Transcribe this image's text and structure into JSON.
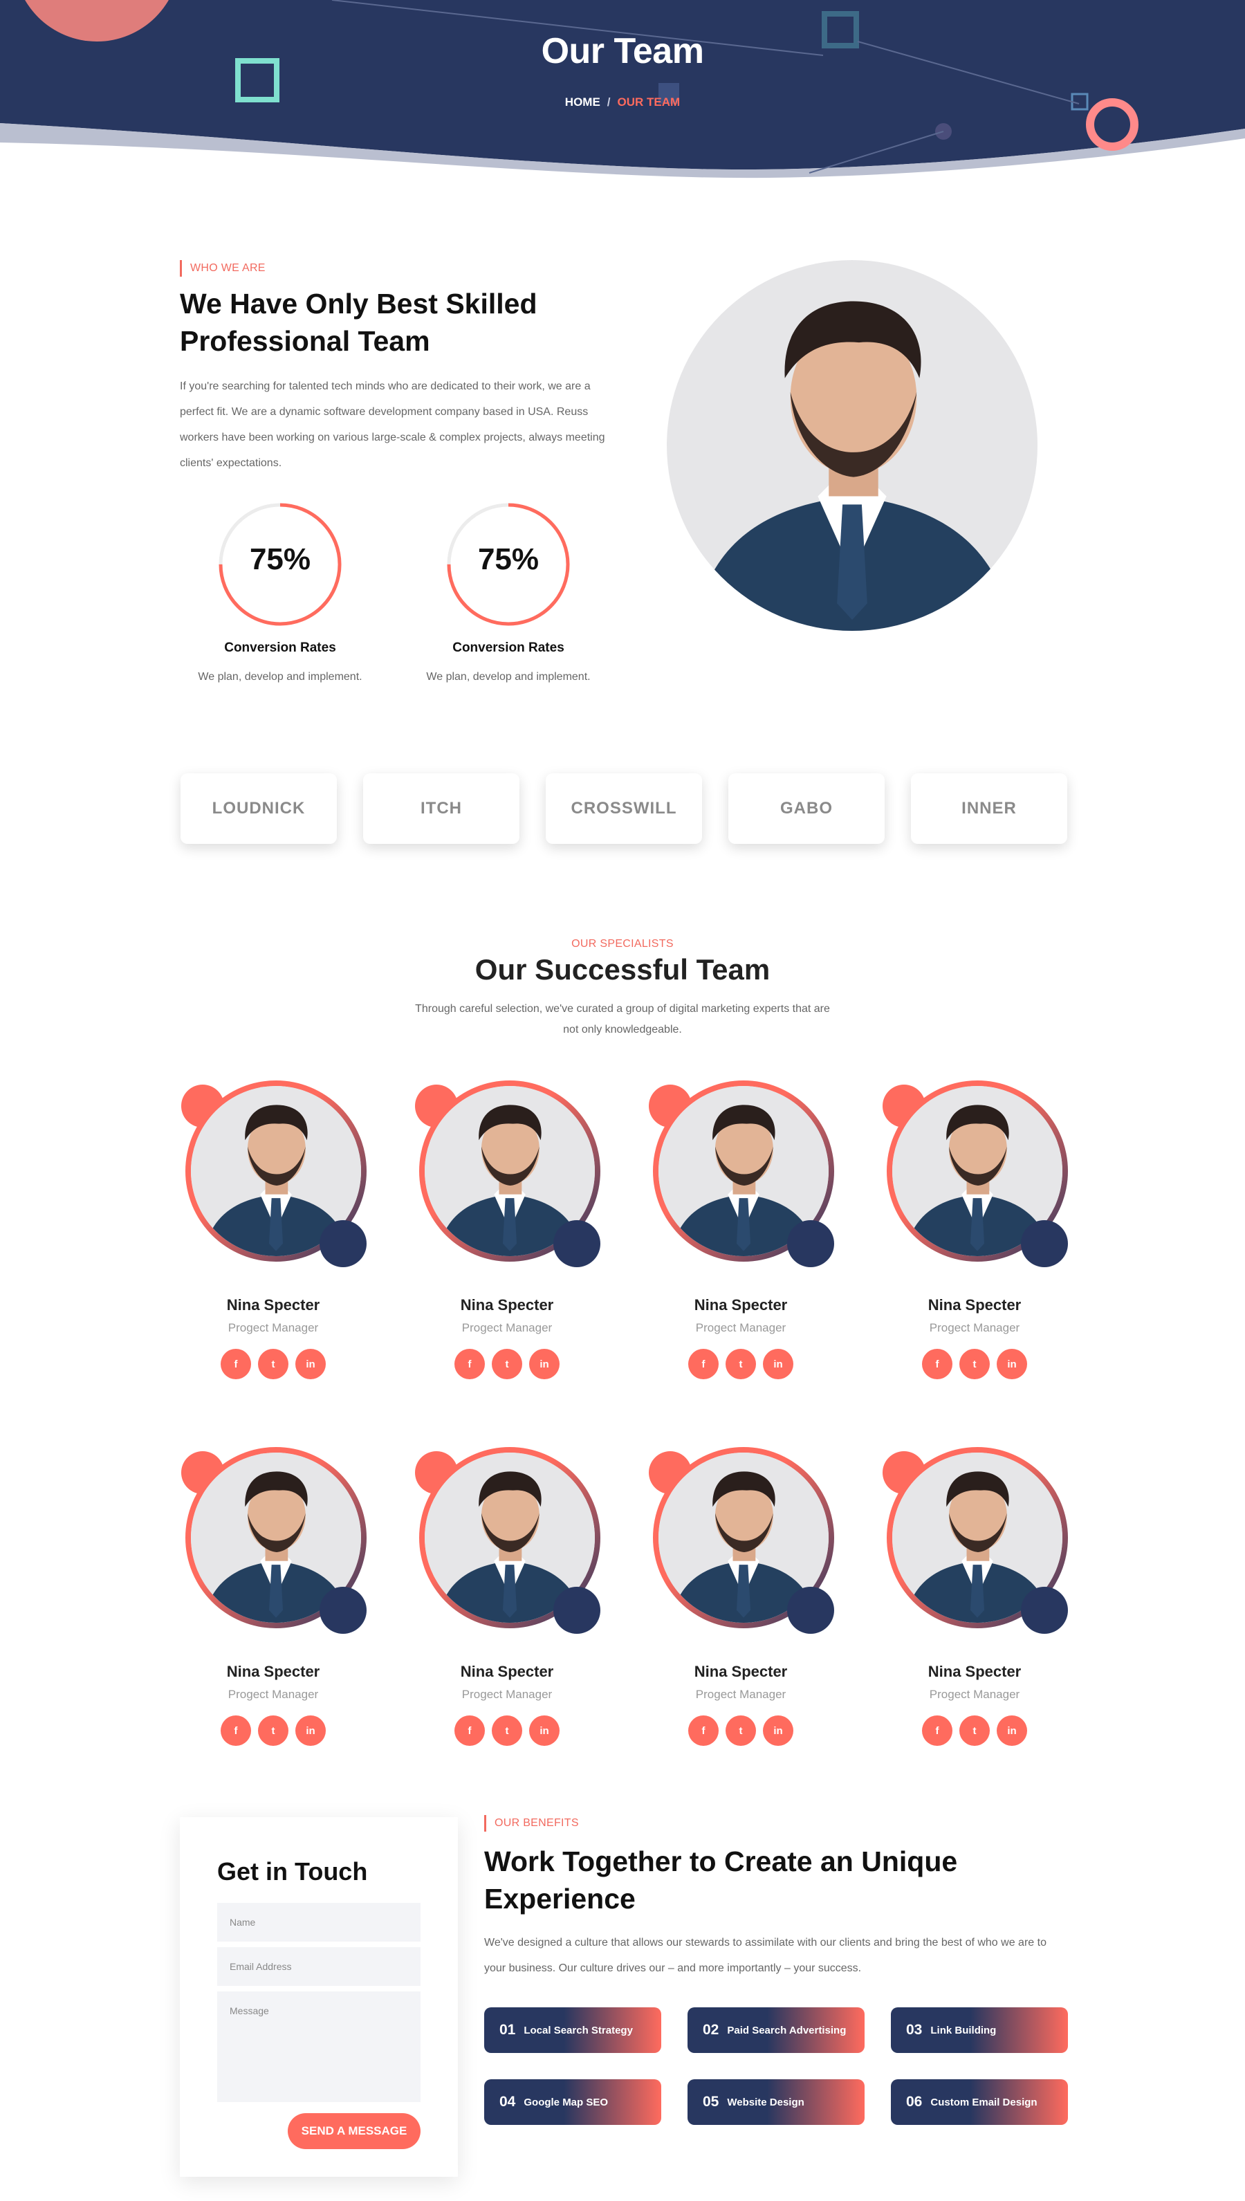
{
  "hero": {
    "title": "Our Team",
    "breadcrumb": {
      "home": "HOME",
      "separator": "/",
      "current": "OUR TEAM"
    }
  },
  "about": {
    "eyebrow": "WHO WE ARE",
    "title": "We Have Only Best Skilled Professional Team",
    "text": "If you're searching for talented tech minds who are dedicated to their work, we are a perfect fit. We are a dynamic software development company based in USA. Reuss workers have been working on various large-scale & complex projects, always meeting clients' expectations.",
    "stats": [
      {
        "value": "75%",
        "percent": 75,
        "label": "Conversion Rates",
        "desc": "We plan, develop and implement."
      },
      {
        "value": "75%",
        "percent": 75,
        "label": "Conversion Rates",
        "desc": "We plan, develop and implement."
      }
    ]
  },
  "logos": [
    "LOUDNICK",
    "ITCH",
    "CROSSWILL",
    "GABO",
    "INNER"
  ],
  "team": {
    "eyebrow": "OUR SPECIALISTS",
    "title": "Our Successful Team",
    "subtitle": "Through careful selection, we've curated a group of digital marketing experts that are not only knowledgeable.",
    "members": [
      {
        "name": "Nina Specter",
        "role": "Progect Manager"
      },
      {
        "name": "Nina Specter",
        "role": "Progect Manager"
      },
      {
        "name": "Nina Specter",
        "role": "Progect Manager"
      },
      {
        "name": "Nina Specter",
        "role": "Progect Manager"
      },
      {
        "name": "Nina Specter",
        "role": "Progect Manager"
      },
      {
        "name": "Nina Specter",
        "role": "Progect Manager"
      },
      {
        "name": "Nina Specter",
        "role": "Progect Manager"
      },
      {
        "name": "Nina Specter",
        "role": "Progect Manager"
      }
    ],
    "social_icons": [
      "facebook-icon",
      "twitter-icon",
      "linkedin-icon"
    ],
    "social_glyphs": [
      "f",
      "t",
      "in"
    ]
  },
  "contact": {
    "title": "Get in Touch",
    "name_placeholder": "Name",
    "email_placeholder": "Email Address",
    "message_placeholder": "Message",
    "submit_label": "SEND A MESSAGE"
  },
  "benefits": {
    "eyebrow": "OUR BENEFITS",
    "title": "Work Together to Create an Unique Experience",
    "text": "We've designed a culture that allows our stewards to assimilate with our clients and bring the best of who we are to your business. Our culture drives our – and more importantly – your success.",
    "items": [
      {
        "num": "01",
        "label": "Local Search Strategy"
      },
      {
        "num": "02",
        "label": "Paid Search Advertising"
      },
      {
        "num": "03",
        "label": "Link Building"
      },
      {
        "num": "04",
        "label": "Google Map SEO"
      },
      {
        "num": "05",
        "label": "Website Design"
      },
      {
        "num": "06",
        "label": "Custom Email Design"
      }
    ]
  },
  "colors": {
    "navy": "#283760",
    "coral": "#ff6b5e",
    "mint": "#7fe0cf"
  }
}
